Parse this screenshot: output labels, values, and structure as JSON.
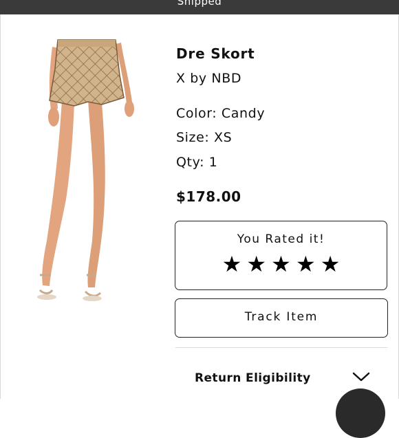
{
  "status_bar": {
    "text": "Shipped"
  },
  "product": {
    "name": "Dre Skort",
    "brand": "X by NBD",
    "color": "Color: Candy",
    "size": "Size: XS",
    "qty": "Qty: 1",
    "price": "$178.00"
  },
  "rating": {
    "label": "You Rated it!",
    "stars": 5,
    "max_stars": 5,
    "star_glyph": "★"
  },
  "actions": {
    "track_label": "Track Item"
  },
  "return_section": {
    "label": "Return Eligibility",
    "icon": "chevron-down-icon"
  },
  "colors": {
    "status_bar_bg": "#3a3a3a",
    "text": "#111111",
    "border": "#222222"
  }
}
